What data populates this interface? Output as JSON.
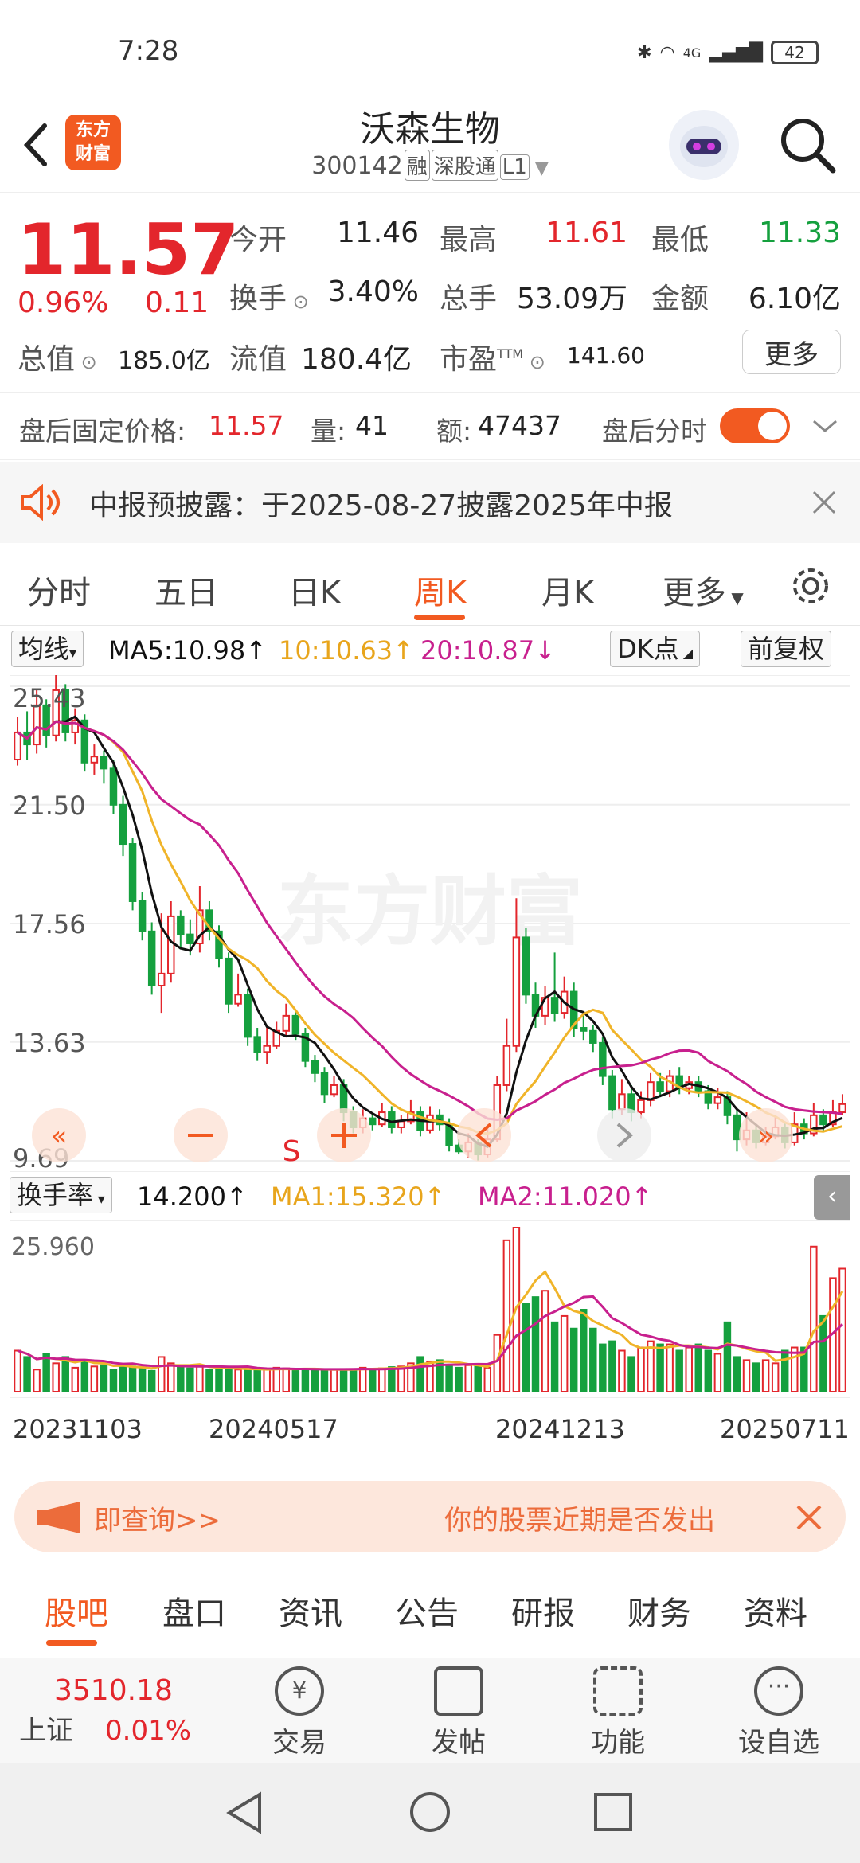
{
  "status": {
    "time": "7:28",
    "network": "4G",
    "battery": "42"
  },
  "header": {
    "logo_line1": "东方",
    "logo_line2": "财富",
    "stock_name": "沃森生物",
    "code": "300142",
    "tags": [
      "融",
      "深股通",
      "L1"
    ]
  },
  "quote": {
    "price": "11.57",
    "change_pct": "0.96%",
    "change_abs": "0.11",
    "open_label": "今开",
    "open": "11.46",
    "high_label": "最高",
    "high": "11.61",
    "low_label": "最低",
    "low": "11.33",
    "turnover_label": "换手",
    "turnover": "3.40%",
    "volume_label": "总手",
    "volume": "53.09万",
    "amount_label": "金额",
    "amount": "6.10亿",
    "mcap_label": "总值",
    "mcap": "185.0亿",
    "float_label": "流值",
    "float_cap": "180.4亿",
    "pe_label": "市盈",
    "pe_sup": "TTM",
    "pe": "141.60",
    "more": "更多"
  },
  "after_hours": {
    "label": "盘后固定价格:",
    "price": "11.57",
    "vol_label": "量:",
    "vol": "41",
    "amt_label": "额:",
    "amt": "47437",
    "toggle_label": "盘后分时",
    "toggle_on": true
  },
  "notice": {
    "text": "中报预披露：于2025-08-27披露2025年中报"
  },
  "period_tabs": [
    "分时",
    "五日",
    "日K",
    "周K",
    "月K",
    "更多"
  ],
  "active_period": "周K",
  "ma": {
    "selector": "均线",
    "ma5": "MA5:10.98↑",
    "ma10": "10:10.63↑",
    "ma20": "20:10.87↓",
    "dk": "DK点",
    "adjust": "前复权"
  },
  "price_axis": [
    "25.43",
    "21.50",
    "17.56",
    "13.63",
    "9.69"
  ],
  "watermark": "东方财富",
  "chart_buttons": {
    "signal": "S"
  },
  "turn": {
    "selector": "换手率",
    "val": "14.200↑",
    "ma1": "MA1:15.320↑",
    "ma2": "MA2:11.020↑",
    "axis_max": "25.960"
  },
  "dates": [
    "20231103",
    "20240517",
    "20241213",
    "20250711"
  ],
  "colors": {
    "up": "#e3262c",
    "down": "#15a03e",
    "ma5": "#111111",
    "ma10": "#f0b429",
    "ma20": "#c8208e",
    "accent": "#f25a21"
  },
  "chart_data": {
    "type": "candlestick",
    "period": "weekly",
    "ylim": [
      9.69,
      25.43
    ],
    "candles": [
      [
        23.0,
        23.9,
        24.4,
        22.8
      ],
      [
        23.9,
        23.5,
        24.6,
        23.0
      ],
      [
        23.5,
        24.8,
        25.3,
        23.2
      ],
      [
        24.8,
        23.8,
        25.0,
        23.4
      ],
      [
        23.8,
        25.3,
        25.8,
        23.6
      ],
      [
        25.3,
        23.9,
        25.5,
        23.6
      ],
      [
        23.9,
        24.3,
        24.7,
        23.5
      ],
      [
        24.3,
        22.9,
        24.5,
        22.6
      ],
      [
        22.9,
        23.1,
        23.5,
        22.5
      ],
      [
        23.1,
        22.7,
        23.3,
        22.2
      ],
      [
        22.7,
        21.5,
        23.0,
        21.2
      ],
      [
        21.5,
        20.2,
        21.8,
        19.8
      ],
      [
        20.2,
        18.3,
        20.4,
        18.0
      ],
      [
        18.3,
        17.3,
        18.6,
        17.0
      ],
      [
        17.3,
        15.5,
        17.6,
        15.2
      ],
      [
        15.5,
        15.9,
        17.9,
        14.6
      ],
      [
        15.9,
        17.8,
        18.3,
        15.6
      ],
      [
        17.8,
        17.2,
        18.0,
        16.7
      ],
      [
        17.2,
        16.9,
        17.7,
        16.5
      ],
      [
        16.9,
        18.0,
        18.8,
        16.6
      ],
      [
        18.0,
        17.3,
        18.3,
        17.0
      ],
      [
        17.3,
        16.4,
        17.5,
        16.1
      ],
      [
        16.4,
        14.9,
        16.6,
        14.6
      ],
      [
        14.9,
        15.2,
        15.9,
        14.8
      ],
      [
        15.2,
        13.8,
        15.4,
        13.5
      ],
      [
        13.8,
        13.3,
        14.1,
        13.0
      ],
      [
        13.3,
        13.5,
        14.2,
        12.9
      ],
      [
        13.5,
        14.0,
        14.3,
        13.4
      ],
      [
        14.0,
        14.5,
        14.9,
        13.8
      ],
      [
        14.5,
        13.9,
        14.7,
        13.7
      ],
      [
        13.9,
        13.0,
        14.1,
        12.8
      ],
      [
        13.0,
        12.6,
        13.2,
        12.3
      ],
      [
        12.6,
        11.9,
        12.8,
        11.6
      ],
      [
        11.9,
        12.2,
        12.5,
        11.8
      ],
      [
        12.2,
        11.3,
        12.4,
        11.0
      ],
      [
        11.3,
        10.8,
        11.5,
        10.6
      ],
      [
        10.8,
        11.1,
        11.4,
        10.6
      ],
      [
        11.1,
        10.9,
        11.3,
        10.7
      ],
      [
        10.9,
        11.3,
        11.6,
        10.8
      ],
      [
        11.3,
        10.8,
        11.5,
        10.6
      ],
      [
        10.8,
        11.0,
        11.2,
        10.6
      ],
      [
        11.0,
        11.3,
        11.7,
        10.9
      ],
      [
        11.3,
        10.7,
        11.5,
        10.5
      ],
      [
        10.7,
        11.2,
        11.5,
        10.6
      ],
      [
        11.2,
        10.9,
        11.4,
        10.7
      ],
      [
        10.9,
        10.2,
        11.1,
        10.0
      ],
      [
        10.2,
        10.0,
        10.4,
        9.9
      ],
      [
        10.0,
        10.3,
        10.6,
        9.8
      ],
      [
        10.3,
        9.9,
        10.4,
        9.7
      ],
      [
        9.9,
        10.4,
        10.9,
        9.8
      ],
      [
        10.4,
        12.2,
        12.5,
        10.3
      ],
      [
        12.2,
        13.5,
        14.4,
        12.0
      ],
      [
        13.5,
        17.1,
        18.4,
        13.3
      ],
      [
        17.1,
        15.2,
        17.4,
        14.9
      ],
      [
        15.2,
        14.5,
        15.6,
        14.1
      ],
      [
        14.5,
        15.1,
        15.5,
        14.2
      ],
      [
        15.1,
        14.6,
        16.6,
        14.3
      ],
      [
        14.6,
        15.3,
        15.8,
        14.4
      ],
      [
        15.3,
        14.1,
        15.6,
        13.8
      ],
      [
        14.1,
        14.0,
        14.6,
        13.7
      ],
      [
        14.0,
        13.6,
        14.2,
        13.3
      ],
      [
        13.6,
        12.5,
        13.8,
        12.2
      ],
      [
        12.5,
        11.4,
        12.7,
        11.1
      ],
      [
        11.4,
        11.9,
        12.4,
        11.2
      ],
      [
        11.9,
        11.3,
        12.2,
        11.0
      ],
      [
        11.3,
        11.7,
        12.0,
        11.1
      ],
      [
        11.7,
        12.3,
        12.6,
        11.5
      ],
      [
        12.3,
        12.0,
        12.6,
        11.8
      ],
      [
        12.0,
        12.5,
        12.7,
        11.8
      ],
      [
        12.5,
        12.1,
        12.8,
        11.9
      ],
      [
        12.1,
        12.3,
        12.5,
        11.9
      ],
      [
        12.3,
        12.0,
        12.5,
        11.8
      ],
      [
        12.0,
        11.6,
        12.2,
        11.4
      ],
      [
        11.6,
        11.8,
        12.1,
        11.4
      ],
      [
        11.8,
        11.2,
        12.0,
        10.9
      ],
      [
        11.2,
        10.4,
        11.4,
        10.0
      ],
      [
        10.4,
        10.7,
        11.3,
        10.2
      ],
      [
        10.7,
        10.3,
        10.9,
        10.1
      ],
      [
        10.3,
        10.5,
        10.8,
        10.2
      ],
      [
        10.5,
        10.8,
        11.2,
        10.4
      ],
      [
        10.8,
        10.3,
        11.0,
        10.1
      ],
      [
        10.3,
        10.9,
        11.3,
        10.2
      ],
      [
        10.9,
        10.6,
        11.1,
        10.4
      ],
      [
        10.6,
        11.2,
        11.6,
        10.5
      ],
      [
        11.2,
        10.9,
        11.4,
        10.7
      ],
      [
        10.9,
        11.3,
        11.7,
        10.8
      ],
      [
        11.3,
        11.57,
        11.9,
        11.2
      ]
    ],
    "turnover": [
      6.5,
      5.5,
      3.5,
      6.0,
      4.5,
      5.5,
      3.8,
      5.0,
      4.0,
      4.2,
      3.5,
      4.0,
      4.0,
      3.6,
      3.3,
      5.5,
      4.5,
      4.0,
      3.7,
      4.0,
      3.5,
      3.8,
      3.6,
      3.5,
      3.6,
      3.4,
      3.5,
      3.8,
      3.7,
      3.5,
      3.6,
      3.5,
      3.4,
      3.5,
      3.6,
      3.5,
      3.8,
      3.6,
      3.7,
      3.9,
      4.0,
      4.5,
      5.5,
      4.8,
      5.0,
      4.0,
      3.8,
      4.2,
      4.0,
      3.8,
      9.0,
      24.0,
      26.0,
      14.0,
      15.0,
      16.0,
      11.0,
      12.0,
      10.0,
      13.0,
      10.0,
      7.5,
      8.0,
      6.5,
      5.5,
      7.0,
      8.0,
      7.5,
      7.5,
      6.5,
      7.0,
      7.5,
      6.5,
      6.0,
      11.0,
      5.5,
      5.0,
      4.5,
      5.0,
      4.5,
      6.5,
      7.0,
      7.0,
      23.0,
      12.0,
      18.0,
      19.5
    ]
  }
}
